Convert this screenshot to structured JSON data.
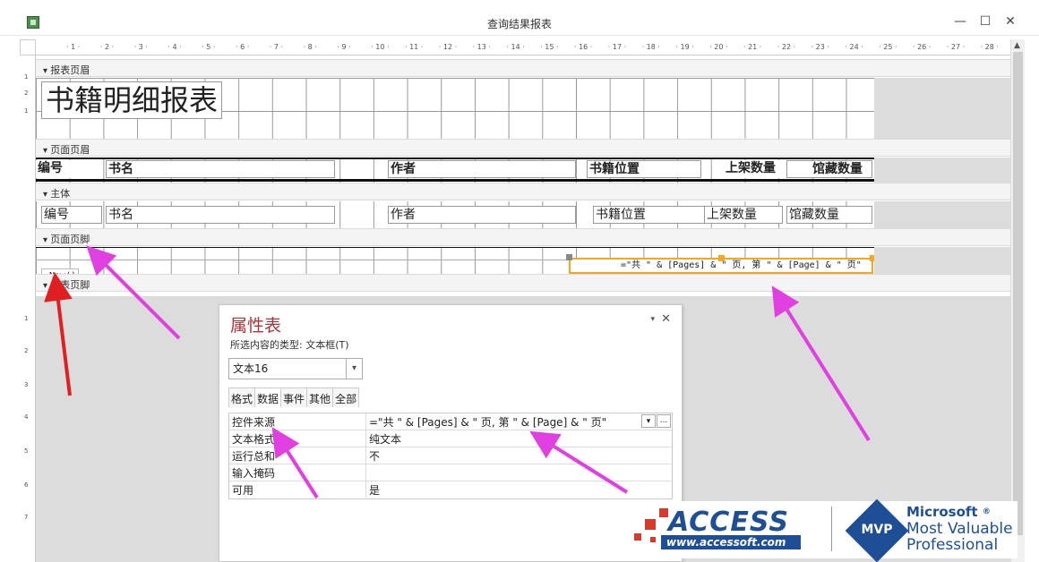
{
  "window": {
    "title": "查询结果报表",
    "minimize": "—",
    "maximize": "☐",
    "close": "✕"
  },
  "ruler": {
    "numbers": [
      "1",
      "2",
      "3",
      "4",
      "5",
      "6",
      "7",
      "8",
      "9",
      "10",
      "11",
      "12",
      "13",
      "14",
      "15",
      "16",
      "17",
      "18",
      "19",
      "20",
      "21",
      "22",
      "23",
      "24",
      "25",
      "26",
      "27",
      "28"
    ],
    "vertical": [
      "1",
      "2",
      "1",
      "1",
      "2",
      "3",
      "4",
      "5",
      "6",
      "7"
    ]
  },
  "sections": {
    "report_header": "报表页眉",
    "page_header": "页面页眉",
    "detail": "主体",
    "page_footer": "页面页脚",
    "report_footer": "报表页脚"
  },
  "report_title": "书籍明细报表",
  "page_header_labels": {
    "id": "编号",
    "name": "书名",
    "author": "作者",
    "location": "书籍位置",
    "shelf_qty": "上架数量",
    "stock_qty": "馆藏数量"
  },
  "detail_fields": {
    "id": "编号",
    "name": "书名",
    "author": "作者",
    "location": "书籍位置",
    "shelf_qty": "上架数量",
    "stock_qty": "馆藏数量"
  },
  "footer": {
    "now": "=Now()",
    "page_expr": "=\"共 \" & [Pages] & \" 页, 第 \" & [Page] & \" 页\""
  },
  "property_sheet": {
    "title": "属性表",
    "selection_type": "所选内容的类型: 文本框(T)",
    "selected_control": "文本16",
    "tabs": [
      "格式",
      "数据",
      "事件",
      "其他",
      "全部"
    ],
    "active_tab": "数据",
    "rows": [
      {
        "key": "控件来源",
        "value": "=\"共 \" & [Pages] & \" 页, 第 \" & [Page] & \" 页\""
      },
      {
        "key": "文本格式",
        "value": "纯文本"
      },
      {
        "key": "运行总和",
        "value": "不"
      },
      {
        "key": "输入掩码",
        "value": ""
      },
      {
        "key": "可用",
        "value": "是"
      }
    ],
    "more_button": "...",
    "dropdown_glyph": "▾",
    "close": "✕",
    "pin": "▾"
  },
  "logo": {
    "access": "ACCESS",
    "url": "www.accessoft.com",
    "mvp": "MVP",
    "microsoft": "Microsoft",
    "reg": "®",
    "line1": "Most Valuable",
    "line2": "Professional"
  },
  "colors": {
    "accent_title": "#a4373a",
    "selection": "#f5a623",
    "arrow": "#e040e0",
    "arrow_red": "#e02020",
    "logo_blue": "#1e4f96"
  }
}
